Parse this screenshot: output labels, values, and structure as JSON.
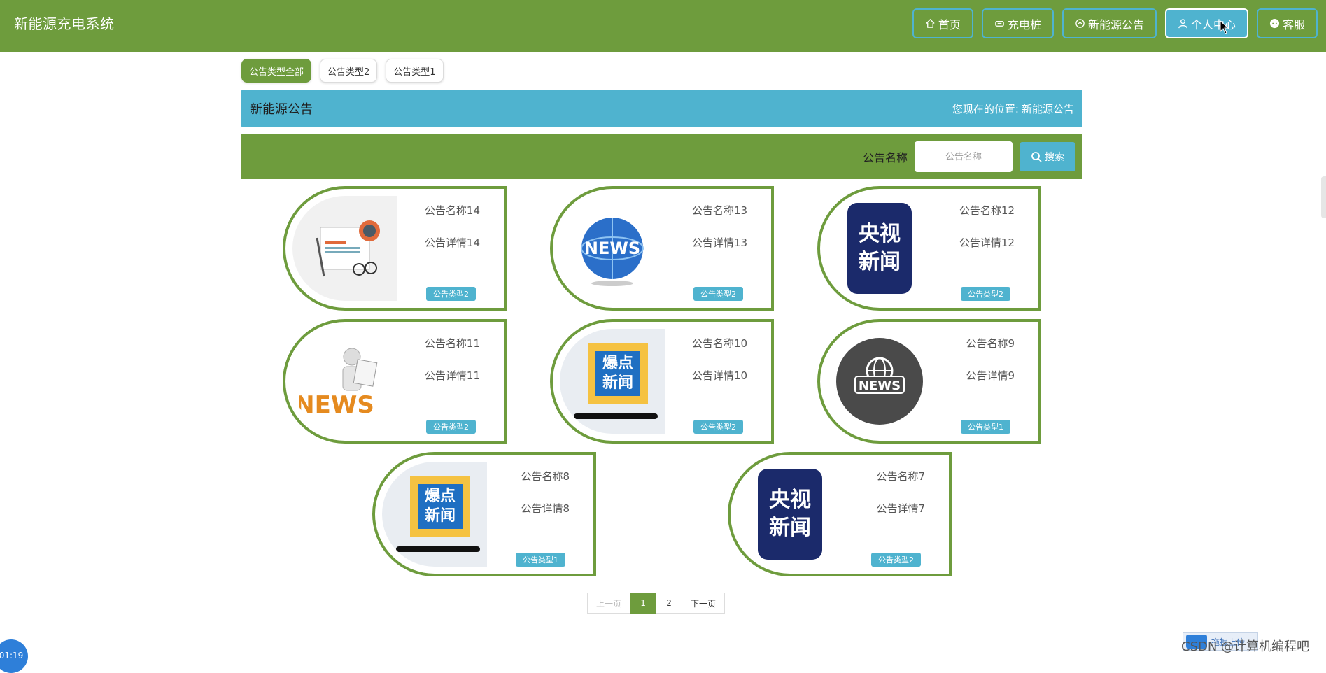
{
  "header": {
    "brand": "新能源充电系统",
    "nav": [
      {
        "label": "首页",
        "icon": "home-icon"
      },
      {
        "label": "充电桩",
        "icon": "charger-icon"
      },
      {
        "label": "新能源公告",
        "icon": "notice-icon"
      },
      {
        "label": "个人中心",
        "icon": "user-icon"
      },
      {
        "label": "客服",
        "icon": "chat-icon"
      }
    ]
  },
  "tabs": [
    "公告类型全部",
    "公告类型2",
    "公告类型1"
  ],
  "titlebar": {
    "title": "新能源公告",
    "crumb_prefix": "您现在的位置:",
    "crumb_current": "新能源公告"
  },
  "search": {
    "label": "公告名称",
    "placeholder": "公告名称",
    "button": "搜索"
  },
  "cards": [
    {
      "name": "公告名称14",
      "detail": "公告详情14",
      "type": "公告类型2",
      "thumb": "news-paper-icon"
    },
    {
      "name": "公告名称13",
      "detail": "公告详情13",
      "type": "公告类型2",
      "thumb": "news-globe-icon",
      "thumb_text": "NEWS"
    },
    {
      "name": "公告名称12",
      "detail": "公告详情12",
      "type": "公告类型2",
      "thumb": "cctv-news-icon",
      "thumb_text": "央视新闻"
    },
    {
      "name": "公告名称11",
      "detail": "公告详情11",
      "type": "公告类型2",
      "thumb": "news-reader-icon",
      "thumb_text": "NEWS"
    },
    {
      "name": "公告名称10",
      "detail": "公告详情10",
      "type": "公告类型2",
      "thumb": "hot-news-icon",
      "thumb_text": "爆点新闻"
    },
    {
      "name": "公告名称9",
      "detail": "公告详情9",
      "type": "公告类型1",
      "thumb": "news-circle-icon",
      "thumb_text": "NEWS"
    },
    {
      "name": "公告名称8",
      "detail": "公告详情8",
      "type": "公告类型1",
      "thumb": "hot-news-icon",
      "thumb_text": "爆点新闻"
    },
    {
      "name": "公告名称7",
      "detail": "公告详情7",
      "type": "公告类型2",
      "thumb": "cctv-news-icon",
      "thumb_text": "央视新闻"
    }
  ],
  "pagination": {
    "prev": "上一页",
    "pages": [
      "1",
      "2"
    ],
    "current": "1",
    "next": "下一页"
  },
  "overlays": {
    "clock": "01:19",
    "watermark": "CSDN @计算机编程吧",
    "upload": "拖拽上传"
  },
  "colors": {
    "primary": "#6e9c3d",
    "accent": "#4fb3cf"
  }
}
